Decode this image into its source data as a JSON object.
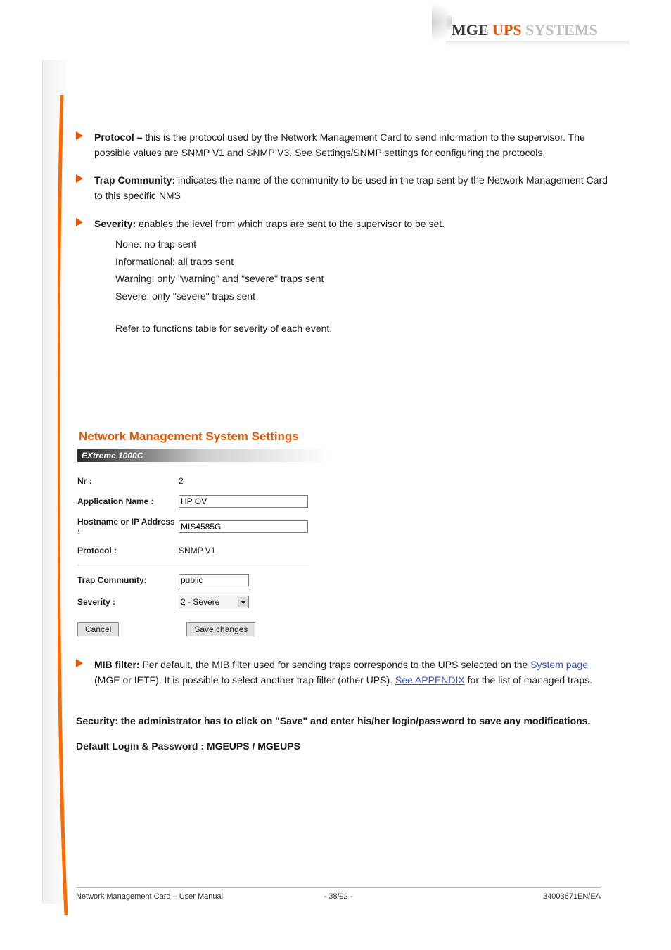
{
  "brand": {
    "mge": "MGE",
    "ups": "UPS",
    "sys": "SYSTEMS"
  },
  "bullets": [
    {
      "prefix": "Protocol – ",
      "text": "this is the protocol used by the Network Management Card to send information to the supervisor. The possible values are SNMP V1 and SNMP V3. See Settings/SNMP settings for configuring the protocols."
    },
    {
      "prefix": "Trap Community: ",
      "text": "indicates the name of the community to be used in the trap sent by the Network Management Card to this specific NMS"
    },
    {
      "prefix": "Severity: ",
      "text": "enables the level from which traps are sent to the supervisor to be set."
    }
  ],
  "severity_levels": [
    "None: no trap sent",
    "Informational: all traps sent",
    "Warning: only \"warning\" and \"severe\" traps sent",
    "Severe: only \"severe\" traps sent"
  ],
  "note_line": "Refer to functions table for severity of each event.",
  "panel_title": "Network Management System Settings",
  "device_label": "EXtreme 1000C",
  "form": {
    "nr_label": "Nr :",
    "nr_value": "2",
    "app_label": "Application Name :",
    "app_value": "HP OV",
    "host_label": "Hostname or IP Address :",
    "host_value": "MIS4585G",
    "proto_label": "Protocol :",
    "proto_value": "SNMP V1",
    "trap_label": "Trap Community:",
    "trap_value": "public",
    "sev_label": "Severity :",
    "sev_value": "2 - Severe"
  },
  "buttons": {
    "cancel": "Cancel",
    "save": "Save changes"
  },
  "mib_bullet": {
    "prefix": "MIB filter: ",
    "text": "Per default, the MIB filter used for sending traps corresponds to the UPS selected on the ",
    "link1": "System page",
    "text2": " (MGE or IETF). It is possible to select another trap filter (other UPS). ",
    "link2": "See APPENDIX",
    "text3": " for the list of managed traps."
  },
  "extra": {
    "security": "Security: the administrator has to click on \"Save\" and enter his/her login/password to save any modifications.",
    "defaults": "Default Login & Password : MGEUPS / MGEUPS"
  },
  "footer": {
    "doc": "Network Management Card – User Manual",
    "page": "- 38/92 -",
    "ref": "34003671EN/EA"
  }
}
